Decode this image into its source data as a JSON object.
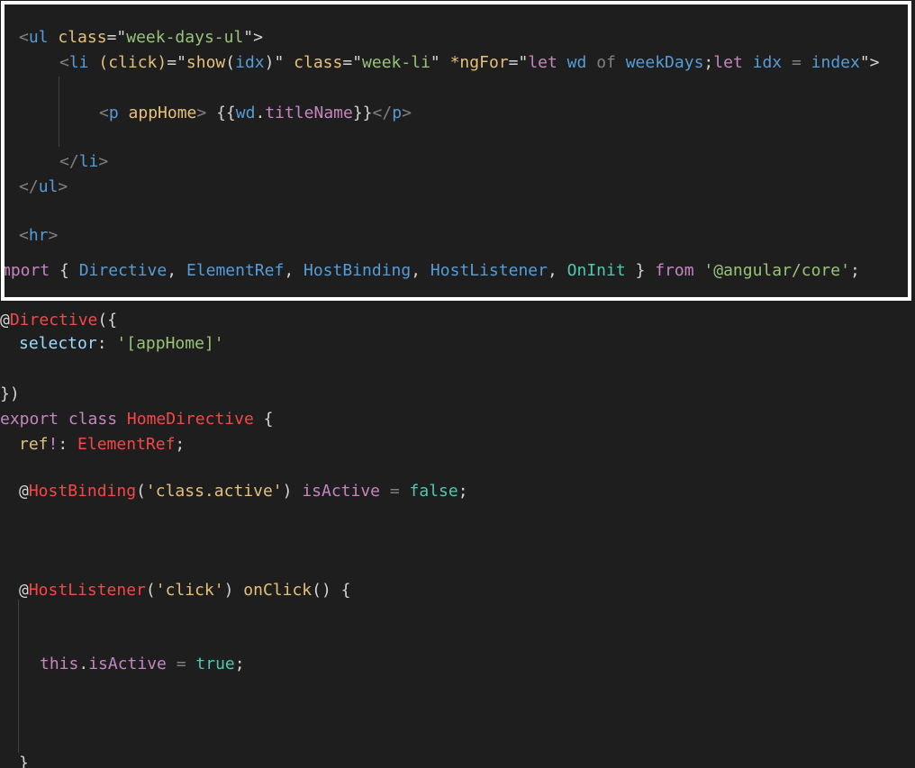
{
  "colors": {
    "background": "#1e1e1e",
    "frame": "#ffffff",
    "tag": "#808080",
    "tag_name": "#569cd6",
    "attribute": "#9cdcfe",
    "string": "#ce9178",
    "keyword": "#569cd6",
    "control_keyword": "#c586c0",
    "decorator": "#f44747",
    "function": "#dcdcaa",
    "type": "#4ec9b0",
    "punctuation": "#d4d4d4"
  },
  "top_snippet": {
    "language": "html",
    "lines": [
      [
        {
          "t": "<",
          "c": "#808080"
        },
        {
          "t": "ul",
          "c": "#569cd6"
        },
        {
          "t": " ",
          "c": "#d4d4d4"
        },
        {
          "t": "class",
          "c": "#e5c07b"
        },
        {
          "t": "=\"",
          "c": "#d4d4d4"
        },
        {
          "t": "week-days-ul",
          "c": "#98c379"
        },
        {
          "t": "\">",
          "c": "#d4d4d4"
        }
      ],
      [
        {
          "t": "<",
          "c": "#808080"
        },
        {
          "t": "li",
          "c": "#569cd6"
        },
        {
          "t": " ",
          "c": "#d4d4d4"
        },
        {
          "t": "(click)",
          "c": "#e5c07b"
        },
        {
          "t": "=\"",
          "c": "#d4d4d4"
        },
        {
          "t": "show",
          "c": "#e5c07b"
        },
        {
          "t": "(",
          "c": "#d4d4d4"
        },
        {
          "t": "idx",
          "c": "#569cd6"
        },
        {
          "t": ")\"",
          "c": "#d4d4d4"
        },
        {
          "t": " ",
          "c": "#d4d4d4"
        },
        {
          "t": "class",
          "c": "#e5c07b"
        },
        {
          "t": "=\"",
          "c": "#d4d4d4"
        },
        {
          "t": "week-li",
          "c": "#98c379"
        },
        {
          "t": "\"",
          "c": "#d4d4d4"
        },
        {
          "t": " ",
          "c": "#d4d4d4"
        },
        {
          "t": "*ngFor",
          "c": "#e5c07b"
        },
        {
          "t": "=\"",
          "c": "#d4d4d4"
        },
        {
          "t": "let",
          "c": "#c586c0"
        },
        {
          "t": " wd ",
          "c": "#569cd6"
        },
        {
          "t": "of",
          "c": "#808080"
        },
        {
          "t": " weekDays",
          "c": "#569cd6"
        },
        {
          "t": ";",
          "c": "#d4d4d4"
        },
        {
          "t": "let",
          "c": "#c586c0"
        },
        {
          "t": " idx ",
          "c": "#569cd6"
        },
        {
          "t": "=",
          "c": "#808080"
        },
        {
          "t": " index",
          "c": "#569cd6"
        },
        {
          "t": "\">",
          "c": "#d4d4d4"
        }
      ],
      [],
      [
        {
          "t": "<",
          "c": "#808080"
        },
        {
          "t": "p",
          "c": "#569cd6"
        },
        {
          "t": " ",
          "c": "#d4d4d4"
        },
        {
          "t": "appHome",
          "c": "#e5c07b"
        },
        {
          "t": ">",
          "c": "#808080"
        },
        {
          "t": " ",
          "c": "#d4d4d4"
        },
        {
          "t": "{{",
          "c": "#d4d4d4"
        },
        {
          "t": "wd",
          "c": "#569cd6"
        },
        {
          "t": ".",
          "c": "#d4d4d4"
        },
        {
          "t": "titleName",
          "c": "#c586c0"
        },
        {
          "t": "}}",
          "c": "#d4d4d4"
        },
        {
          "t": "</",
          "c": "#808080"
        },
        {
          "t": "p",
          "c": "#569cd6"
        },
        {
          "t": ">",
          "c": "#808080"
        }
      ],
      [],
      [
        {
          "t": "</",
          "c": "#808080"
        },
        {
          "t": "li",
          "c": "#569cd6"
        },
        {
          "t": ">",
          "c": "#808080"
        }
      ],
      [
        {
          "t": "</",
          "c": "#808080"
        },
        {
          "t": "ul",
          "c": "#569cd6"
        },
        {
          "t": ">",
          "c": "#808080"
        }
      ],
      [],
      [
        {
          "t": "<",
          "c": "#808080"
        },
        {
          "t": "hr",
          "c": "#569cd6"
        },
        {
          "t": ">",
          "c": "#808080"
        }
      ],
      [
        {
          "t": "mport",
          "c": "#c586c0"
        },
        {
          "t": " { ",
          "c": "#d4d4d4"
        },
        {
          "t": "Directive",
          "c": "#569cd6"
        },
        {
          "t": ", ",
          "c": "#d4d4d4"
        },
        {
          "t": "ElementRef",
          "c": "#569cd6"
        },
        {
          "t": ", ",
          "c": "#d4d4d4"
        },
        {
          "t": "HostBinding",
          "c": "#569cd6"
        },
        {
          "t": ", ",
          "c": "#d4d4d4"
        },
        {
          "t": "HostListener",
          "c": "#569cd6"
        },
        {
          "t": ", ",
          "c": "#d4d4d4"
        },
        {
          "t": "OnInit",
          "c": "#4ec9b0"
        },
        {
          "t": " } ",
          "c": "#d4d4d4"
        },
        {
          "t": "from",
          "c": "#c586c0"
        },
        {
          "t": " ",
          "c": "#d4d4d4"
        },
        {
          "t": "'@angular/core'",
          "c": "#98c379"
        },
        {
          "t": ";",
          "c": "#d4d4d4"
        }
      ]
    ]
  },
  "bottom_snippet": {
    "language": "typescript",
    "lines": [
      [
        {
          "t": "@",
          "c": "#d4d4d4"
        },
        {
          "t": "Directive",
          "c": "#f44747"
        },
        {
          "t": "({",
          "c": "#d4d4d4"
        }
      ],
      [
        {
          "t": "selector",
          "c": "#9cdcfe"
        },
        {
          "t": ": ",
          "c": "#d4d4d4"
        },
        {
          "t": "'[appHome]'",
          "c": "#98c379"
        }
      ],
      [],
      [
        {
          "t": "})",
          "c": "#d4d4d4"
        }
      ],
      [
        {
          "t": "export",
          "c": "#c586c0"
        },
        {
          "t": " ",
          "c": "#d4d4d4"
        },
        {
          "t": "class",
          "c": "#c586c0"
        },
        {
          "t": " ",
          "c": "#d4d4d4"
        },
        {
          "t": "HomeDirective",
          "c": "#f44747"
        },
        {
          "t": " {",
          "c": "#d4d4d4"
        }
      ],
      [
        {
          "t": "ref",
          "c": "#e5c07b"
        },
        {
          "t": "!",
          "c": "#c586c0"
        },
        {
          "t": ": ",
          "c": "#d4d4d4"
        },
        {
          "t": "ElementRef",
          "c": "#f44747"
        },
        {
          "t": ";",
          "c": "#d4d4d4"
        }
      ],
      [],
      [
        {
          "t": "@",
          "c": "#d4d4d4"
        },
        {
          "t": "HostBinding",
          "c": "#f44747"
        },
        {
          "t": "(",
          "c": "#d4d4d4"
        },
        {
          "t": "'class.active'",
          "c": "#e5c07b"
        },
        {
          "t": ") ",
          "c": "#d4d4d4"
        },
        {
          "t": "isActive",
          "c": "#c586c0"
        },
        {
          "t": " = ",
          "c": "#808080"
        },
        {
          "t": "false",
          "c": "#4ec9b0"
        },
        {
          "t": ";",
          "c": "#d4d4d4"
        }
      ],
      [],
      [],
      [],
      [],
      [
        {
          "t": "@",
          "c": "#d4d4d4"
        },
        {
          "t": "HostListener",
          "c": "#f44747"
        },
        {
          "t": "(",
          "c": "#d4d4d4"
        },
        {
          "t": "'click'",
          "c": "#e5c07b"
        },
        {
          "t": ") ",
          "c": "#d4d4d4"
        },
        {
          "t": "onClick",
          "c": "#e5c07b"
        },
        {
          "t": "() {",
          "c": "#d4d4d4"
        }
      ],
      [],
      [],
      [
        {
          "t": "this",
          "c": "#c586c0"
        },
        {
          "t": ".",
          "c": "#d4d4d4"
        },
        {
          "t": "isActive",
          "c": "#c586c0"
        },
        {
          "t": " = ",
          "c": "#808080"
        },
        {
          "t": "true",
          "c": "#4ec9b0"
        },
        {
          "t": ";",
          "c": "#d4d4d4"
        }
      ],
      [],
      [],
      [],
      [
        {
          "t": "}",
          "c": "#d4d4d4"
        }
      ]
    ]
  }
}
